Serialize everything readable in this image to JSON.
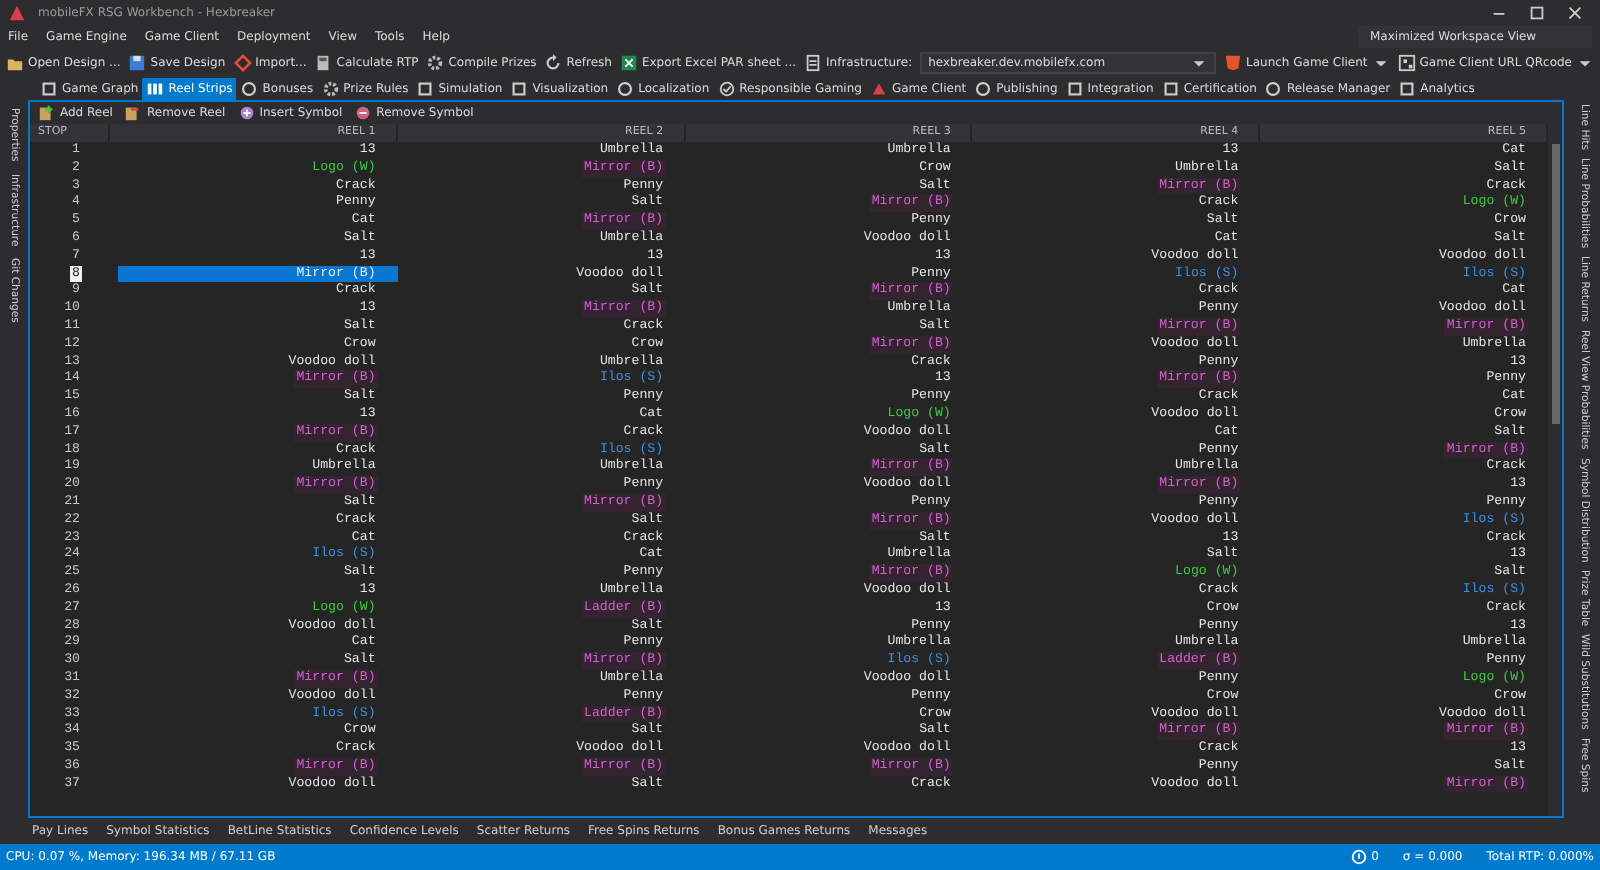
{
  "window": {
    "title": "mobileFX RSG Workbench - Hexbreaker"
  },
  "menu": [
    "File",
    "Game Engine",
    "Game Client",
    "Deployment",
    "View",
    "Tools",
    "Help"
  ],
  "workspace_view": {
    "value": "Maximized Workspace View"
  },
  "toolbar": [
    {
      "kind": "button",
      "label": "Open Design ..."
    },
    {
      "kind": "button",
      "label": "Save Design"
    },
    {
      "kind": "button",
      "label": "Import..."
    },
    {
      "kind": "button",
      "label": "Calculate RTP"
    },
    {
      "kind": "button",
      "label": "Compile Prizes"
    },
    {
      "kind": "button",
      "label": "Refresh"
    },
    {
      "kind": "button",
      "label": "Export Excel PAR sheet ..."
    },
    {
      "kind": "label",
      "label": "Infrastructure:"
    },
    {
      "kind": "combo",
      "label": "hexbreaker.dev.mobilefx.com"
    },
    {
      "kind": "split",
      "label": "Launch Game Client"
    },
    {
      "kind": "split",
      "label": "Game Client URL QRcode"
    }
  ],
  "tabs": [
    {
      "label": "Game Graph",
      "selected": false
    },
    {
      "label": "Reel Strips",
      "selected": true
    },
    {
      "label": "Bonuses",
      "selected": false
    },
    {
      "label": "Prize Rules",
      "selected": false
    },
    {
      "label": "Simulation",
      "selected": false
    },
    {
      "label": "Visualization",
      "selected": false
    },
    {
      "label": "Localization",
      "selected": false
    },
    {
      "label": "Responsible Gaming",
      "selected": false
    },
    {
      "label": "Game Client",
      "selected": false
    },
    {
      "label": "Publishing",
      "selected": false
    },
    {
      "label": "Integration",
      "selected": false
    },
    {
      "label": "Certification",
      "selected": false
    },
    {
      "label": "Release Manager",
      "selected": false
    },
    {
      "label": "Analytics",
      "selected": false
    }
  ],
  "reel_toolbar": [
    "Add Reel",
    "Remove Reel",
    "Insert Symbol",
    "Remove Symbol"
  ],
  "left_panels": [
    "Properties",
    "Infrastructure",
    "Git Changes"
  ],
  "right_panels": [
    "Line Hits",
    "Line Probabilities",
    "Line Returns",
    "Reel View Probabilities",
    "Symbol Distribution",
    "Prize Table",
    "Wild Substitutions",
    "Free Spins"
  ],
  "grid": {
    "stop_header": "STOP",
    "columns": [
      "REEL 1",
      "REEL 2",
      "REEL 3",
      "REEL 4",
      "REEL 5"
    ],
    "rows": [
      {
        "stop": "1",
        "selected": false,
        "cells": [
          {
            "symbol": "13",
            "kind": "plain"
          },
          {
            "symbol": "Umbrella",
            "kind": "plain"
          },
          {
            "symbol": "Umbrella",
            "kind": "plain"
          },
          {
            "symbol": "13",
            "kind": "plain"
          },
          {
            "symbol": "Cat",
            "kind": "plain"
          }
        ]
      },
      {
        "stop": "2",
        "selected": false,
        "cells": [
          {
            "symbol": "Logo (W)",
            "kind": "wild"
          },
          {
            "symbol": "Mirror (B)",
            "kind": "bonus"
          },
          {
            "symbol": "Crow",
            "kind": "plain"
          },
          {
            "symbol": "Umbrella",
            "kind": "plain"
          },
          {
            "symbol": "Salt",
            "kind": "plain"
          }
        ]
      },
      {
        "stop": "3",
        "selected": false,
        "cells": [
          {
            "symbol": "Crack",
            "kind": "plain"
          },
          {
            "symbol": "Penny",
            "kind": "plain"
          },
          {
            "symbol": "Salt",
            "kind": "plain"
          },
          {
            "symbol": "Mirror (B)",
            "kind": "bonus"
          },
          {
            "symbol": "Crack",
            "kind": "plain"
          }
        ]
      },
      {
        "stop": "4",
        "selected": false,
        "cells": [
          {
            "symbol": "Penny",
            "kind": "plain"
          },
          {
            "symbol": "Salt",
            "kind": "plain"
          },
          {
            "symbol": "Mirror (B)",
            "kind": "bonus"
          },
          {
            "symbol": "Crack",
            "kind": "plain"
          },
          {
            "symbol": "Logo (W)",
            "kind": "wild"
          }
        ]
      },
      {
        "stop": "5",
        "selected": false,
        "cells": [
          {
            "symbol": "Cat",
            "kind": "plain"
          },
          {
            "symbol": "Mirror (B)",
            "kind": "bonus"
          },
          {
            "symbol": "Penny",
            "kind": "plain"
          },
          {
            "symbol": "Salt",
            "kind": "plain"
          },
          {
            "symbol": "Crow",
            "kind": "plain"
          }
        ]
      },
      {
        "stop": "6",
        "selected": false,
        "cells": [
          {
            "symbol": "Salt",
            "kind": "plain"
          },
          {
            "symbol": "Umbrella",
            "kind": "plain"
          },
          {
            "symbol": "Voodoo doll",
            "kind": "plain"
          },
          {
            "symbol": "Cat",
            "kind": "plain"
          },
          {
            "symbol": "Salt",
            "kind": "plain"
          }
        ]
      },
      {
        "stop": "7",
        "selected": false,
        "cells": [
          {
            "symbol": "13",
            "kind": "plain"
          },
          {
            "symbol": "13",
            "kind": "plain"
          },
          {
            "symbol": "13",
            "kind": "plain"
          },
          {
            "symbol": "Voodoo doll",
            "kind": "plain"
          },
          {
            "symbol": "Voodoo doll",
            "kind": "plain"
          }
        ]
      },
      {
        "stop": "8",
        "selected": true,
        "cells": [
          {
            "symbol": "Mirror (B)",
            "kind": "bonus"
          },
          {
            "symbol": "Voodoo doll",
            "kind": "plain"
          },
          {
            "symbol": "Penny",
            "kind": "plain"
          },
          {
            "symbol": "Ilos (S)",
            "kind": "scatter"
          },
          {
            "symbol": "Ilos (S)",
            "kind": "scatter"
          }
        ]
      },
      {
        "stop": "9",
        "selected": false,
        "cells": [
          {
            "symbol": "Crack",
            "kind": "plain"
          },
          {
            "symbol": "Salt",
            "kind": "plain"
          },
          {
            "symbol": "Mirror (B)",
            "kind": "bonus"
          },
          {
            "symbol": "Crack",
            "kind": "plain"
          },
          {
            "symbol": "Cat",
            "kind": "plain"
          }
        ]
      },
      {
        "stop": "10",
        "selected": false,
        "cells": [
          {
            "symbol": "13",
            "kind": "plain"
          },
          {
            "symbol": "Mirror (B)",
            "kind": "bonus"
          },
          {
            "symbol": "Umbrella",
            "kind": "plain"
          },
          {
            "symbol": "Penny",
            "kind": "plain"
          },
          {
            "symbol": "Voodoo doll",
            "kind": "plain"
          }
        ]
      },
      {
        "stop": "11",
        "selected": false,
        "cells": [
          {
            "symbol": "Salt",
            "kind": "plain"
          },
          {
            "symbol": "Crack",
            "kind": "plain"
          },
          {
            "symbol": "Salt",
            "kind": "plain"
          },
          {
            "symbol": "Mirror (B)",
            "kind": "bonus"
          },
          {
            "symbol": "Mirror (B)",
            "kind": "bonus"
          }
        ]
      },
      {
        "stop": "12",
        "selected": false,
        "cells": [
          {
            "symbol": "Crow",
            "kind": "plain"
          },
          {
            "symbol": "Crow",
            "kind": "plain"
          },
          {
            "symbol": "Mirror (B)",
            "kind": "bonus"
          },
          {
            "symbol": "Voodoo doll",
            "kind": "plain"
          },
          {
            "symbol": "Umbrella",
            "kind": "plain"
          }
        ]
      },
      {
        "stop": "13",
        "selected": false,
        "cells": [
          {
            "symbol": "Voodoo doll",
            "kind": "plain"
          },
          {
            "symbol": "Umbrella",
            "kind": "plain"
          },
          {
            "symbol": "Crack",
            "kind": "plain"
          },
          {
            "symbol": "Penny",
            "kind": "plain"
          },
          {
            "symbol": "13",
            "kind": "plain"
          }
        ]
      },
      {
        "stop": "14",
        "selected": false,
        "cells": [
          {
            "symbol": "Mirror (B)",
            "kind": "bonus"
          },
          {
            "symbol": "Ilos (S)",
            "kind": "scatter"
          },
          {
            "symbol": "13",
            "kind": "plain"
          },
          {
            "symbol": "Mirror (B)",
            "kind": "bonus"
          },
          {
            "symbol": "Penny",
            "kind": "plain"
          }
        ]
      },
      {
        "stop": "15",
        "selected": false,
        "cells": [
          {
            "symbol": "Salt",
            "kind": "plain"
          },
          {
            "symbol": "Penny",
            "kind": "plain"
          },
          {
            "symbol": "Penny",
            "kind": "plain"
          },
          {
            "symbol": "Crack",
            "kind": "plain"
          },
          {
            "symbol": "Cat",
            "kind": "plain"
          }
        ]
      },
      {
        "stop": "16",
        "selected": false,
        "cells": [
          {
            "symbol": "13",
            "kind": "plain"
          },
          {
            "symbol": "Cat",
            "kind": "plain"
          },
          {
            "symbol": "Logo (W)",
            "kind": "wild"
          },
          {
            "symbol": "Voodoo doll",
            "kind": "plain"
          },
          {
            "symbol": "Crow",
            "kind": "plain"
          }
        ]
      },
      {
        "stop": "17",
        "selected": false,
        "cells": [
          {
            "symbol": "Mirror (B)",
            "kind": "bonus"
          },
          {
            "symbol": "Crack",
            "kind": "plain"
          },
          {
            "symbol": "Voodoo doll",
            "kind": "plain"
          },
          {
            "symbol": "Cat",
            "kind": "plain"
          },
          {
            "symbol": "Salt",
            "kind": "plain"
          }
        ]
      },
      {
        "stop": "18",
        "selected": false,
        "cells": [
          {
            "symbol": "Crack",
            "kind": "plain"
          },
          {
            "symbol": "Ilos (S)",
            "kind": "scatter"
          },
          {
            "symbol": "Salt",
            "kind": "plain"
          },
          {
            "symbol": "Penny",
            "kind": "plain"
          },
          {
            "symbol": "Mirror (B)",
            "kind": "bonus"
          }
        ]
      },
      {
        "stop": "19",
        "selected": false,
        "cells": [
          {
            "symbol": "Umbrella",
            "kind": "plain"
          },
          {
            "symbol": "Umbrella",
            "kind": "plain"
          },
          {
            "symbol": "Mirror (B)",
            "kind": "bonus"
          },
          {
            "symbol": "Umbrella",
            "kind": "plain"
          },
          {
            "symbol": "Crack",
            "kind": "plain"
          }
        ]
      },
      {
        "stop": "20",
        "selected": false,
        "cells": [
          {
            "symbol": "Mirror (B)",
            "kind": "bonus"
          },
          {
            "symbol": "Penny",
            "kind": "plain"
          },
          {
            "symbol": "Voodoo doll",
            "kind": "plain"
          },
          {
            "symbol": "Mirror (B)",
            "kind": "bonus"
          },
          {
            "symbol": "13",
            "kind": "plain"
          }
        ]
      },
      {
        "stop": "21",
        "selected": false,
        "cells": [
          {
            "symbol": "Salt",
            "kind": "plain"
          },
          {
            "symbol": "Mirror (B)",
            "kind": "bonus"
          },
          {
            "symbol": "Penny",
            "kind": "plain"
          },
          {
            "symbol": "Penny",
            "kind": "plain"
          },
          {
            "symbol": "Penny",
            "kind": "plain"
          }
        ]
      },
      {
        "stop": "22",
        "selected": false,
        "cells": [
          {
            "symbol": "Crack",
            "kind": "plain"
          },
          {
            "symbol": "Salt",
            "kind": "plain"
          },
          {
            "symbol": "Mirror (B)",
            "kind": "bonus"
          },
          {
            "symbol": "Voodoo doll",
            "kind": "plain"
          },
          {
            "symbol": "Ilos (S)",
            "kind": "scatter"
          }
        ]
      },
      {
        "stop": "23",
        "selected": false,
        "cells": [
          {
            "symbol": "Cat",
            "kind": "plain"
          },
          {
            "symbol": "Crack",
            "kind": "plain"
          },
          {
            "symbol": "Salt",
            "kind": "plain"
          },
          {
            "symbol": "13",
            "kind": "plain"
          },
          {
            "symbol": "Crack",
            "kind": "plain"
          }
        ]
      },
      {
        "stop": "24",
        "selected": false,
        "cells": [
          {
            "symbol": "Ilos (S)",
            "kind": "scatter"
          },
          {
            "symbol": "Cat",
            "kind": "plain"
          },
          {
            "symbol": "Umbrella",
            "kind": "plain"
          },
          {
            "symbol": "Salt",
            "kind": "plain"
          },
          {
            "symbol": "13",
            "kind": "plain"
          }
        ]
      },
      {
        "stop": "25",
        "selected": false,
        "cells": [
          {
            "symbol": "Salt",
            "kind": "plain"
          },
          {
            "symbol": "Penny",
            "kind": "plain"
          },
          {
            "symbol": "Mirror (B)",
            "kind": "bonus"
          },
          {
            "symbol": "Logo (W)",
            "kind": "wild"
          },
          {
            "symbol": "Salt",
            "kind": "plain"
          }
        ]
      },
      {
        "stop": "26",
        "selected": false,
        "cells": [
          {
            "symbol": "13",
            "kind": "plain"
          },
          {
            "symbol": "Umbrella",
            "kind": "plain"
          },
          {
            "symbol": "Voodoo doll",
            "kind": "plain"
          },
          {
            "symbol": "Crack",
            "kind": "plain"
          },
          {
            "symbol": "Ilos (S)",
            "kind": "scatter"
          }
        ]
      },
      {
        "stop": "27",
        "selected": false,
        "cells": [
          {
            "symbol": "Logo (W)",
            "kind": "wild"
          },
          {
            "symbol": "Ladder (B)",
            "kind": "bonus"
          },
          {
            "symbol": "13",
            "kind": "plain"
          },
          {
            "symbol": "Crow",
            "kind": "plain"
          },
          {
            "symbol": "Crack",
            "kind": "plain"
          }
        ]
      },
      {
        "stop": "28",
        "selected": false,
        "cells": [
          {
            "symbol": "Voodoo doll",
            "kind": "plain"
          },
          {
            "symbol": "Salt",
            "kind": "plain"
          },
          {
            "symbol": "Penny",
            "kind": "plain"
          },
          {
            "symbol": "Penny",
            "kind": "plain"
          },
          {
            "symbol": "13",
            "kind": "plain"
          }
        ]
      },
      {
        "stop": "29",
        "selected": false,
        "cells": [
          {
            "symbol": "Cat",
            "kind": "plain"
          },
          {
            "symbol": "Penny",
            "kind": "plain"
          },
          {
            "symbol": "Umbrella",
            "kind": "plain"
          },
          {
            "symbol": "Umbrella",
            "kind": "plain"
          },
          {
            "symbol": "Umbrella",
            "kind": "plain"
          }
        ]
      },
      {
        "stop": "30",
        "selected": false,
        "cells": [
          {
            "symbol": "Salt",
            "kind": "plain"
          },
          {
            "symbol": "Mirror (B)",
            "kind": "bonus"
          },
          {
            "symbol": "Ilos (S)",
            "kind": "scatter"
          },
          {
            "symbol": "Ladder (B)",
            "kind": "bonus"
          },
          {
            "symbol": "Penny",
            "kind": "plain"
          }
        ]
      },
      {
        "stop": "31",
        "selected": false,
        "cells": [
          {
            "symbol": "Mirror (B)",
            "kind": "bonus"
          },
          {
            "symbol": "Umbrella",
            "kind": "plain"
          },
          {
            "symbol": "Voodoo doll",
            "kind": "plain"
          },
          {
            "symbol": "Penny",
            "kind": "plain"
          },
          {
            "symbol": "Logo (W)",
            "kind": "wild"
          }
        ]
      },
      {
        "stop": "32",
        "selected": false,
        "cells": [
          {
            "symbol": "Voodoo doll",
            "kind": "plain"
          },
          {
            "symbol": "Penny",
            "kind": "plain"
          },
          {
            "symbol": "Penny",
            "kind": "plain"
          },
          {
            "symbol": "Crow",
            "kind": "plain"
          },
          {
            "symbol": "Crow",
            "kind": "plain"
          }
        ]
      },
      {
        "stop": "33",
        "selected": false,
        "cells": [
          {
            "symbol": "Ilos (S)",
            "kind": "scatter"
          },
          {
            "symbol": "Ladder (B)",
            "kind": "bonus"
          },
          {
            "symbol": "Crow",
            "kind": "plain"
          },
          {
            "symbol": "Voodoo doll",
            "kind": "plain"
          },
          {
            "symbol": "Voodoo doll",
            "kind": "plain"
          }
        ]
      },
      {
        "stop": "34",
        "selected": false,
        "cells": [
          {
            "symbol": "Crow",
            "kind": "plain"
          },
          {
            "symbol": "Salt",
            "kind": "plain"
          },
          {
            "symbol": "Salt",
            "kind": "plain"
          },
          {
            "symbol": "Mirror (B)",
            "kind": "bonus"
          },
          {
            "symbol": "Mirror (B)",
            "kind": "bonus"
          }
        ]
      },
      {
        "stop": "35",
        "selected": false,
        "cells": [
          {
            "symbol": "Crack",
            "kind": "plain"
          },
          {
            "symbol": "Voodoo doll",
            "kind": "plain"
          },
          {
            "symbol": "Voodoo doll",
            "kind": "plain"
          },
          {
            "symbol": "Crack",
            "kind": "plain"
          },
          {
            "symbol": "13",
            "kind": "plain"
          }
        ]
      },
      {
        "stop": "36",
        "selected": false,
        "cells": [
          {
            "symbol": "Mirror (B)",
            "kind": "bonus"
          },
          {
            "symbol": "Mirror (B)",
            "kind": "bonus"
          },
          {
            "symbol": "Mirror (B)",
            "kind": "bonus"
          },
          {
            "symbol": "Penny",
            "kind": "plain"
          },
          {
            "symbol": "Salt",
            "kind": "plain"
          }
        ]
      },
      {
        "stop": "37",
        "selected": false,
        "cells": [
          {
            "symbol": "Voodoo doll",
            "kind": "plain"
          },
          {
            "symbol": "Salt",
            "kind": "plain"
          },
          {
            "symbol": "Crack",
            "kind": "plain"
          },
          {
            "symbol": "Voodoo doll",
            "kind": "plain"
          },
          {
            "symbol": "Mirror (B)",
            "kind": "bonus"
          }
        ]
      }
    ]
  },
  "bottom_tabs": [
    "Pay Lines",
    "Symbol Statistics",
    "BetLine Statistics",
    "Confidence Levels",
    "Scatter Returns",
    "Free Spins Returns",
    "Bonus Games Returns",
    "Messages"
  ],
  "status_bar": {
    "resources": "CPU: 0.07 %, Memory: 196.34 MB / 67.11 GB",
    "errors": "0",
    "sigma": "σ = 0.000",
    "rtp": "Total RTP: 0.000%"
  }
}
